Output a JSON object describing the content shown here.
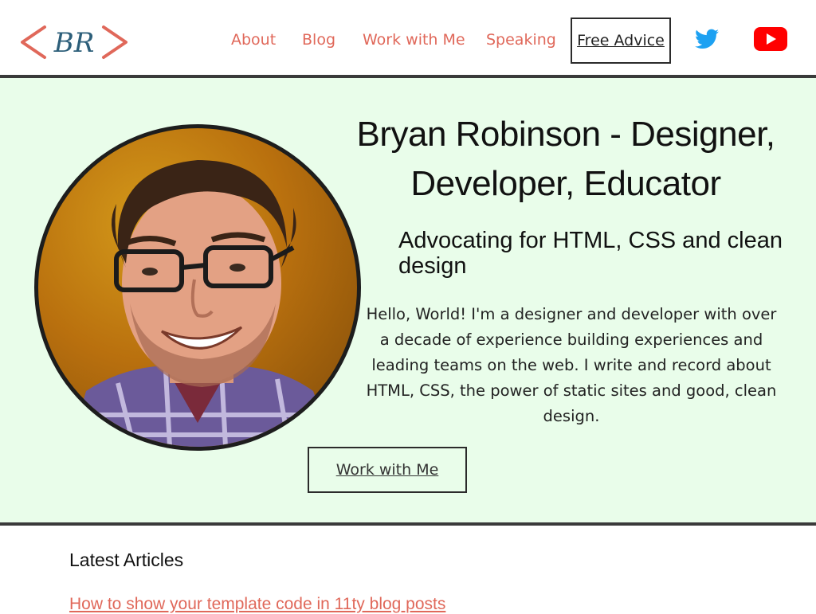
{
  "header": {
    "logo_text": "BR",
    "nav": {
      "about": "About",
      "blog": "Blog",
      "work_with_me": "Work with Me",
      "speaking": "Speaking"
    },
    "free_advice": "Free Advice",
    "social": {
      "twitter_icon": "twitter-icon",
      "youtube_icon": "youtube-icon"
    }
  },
  "hero": {
    "title": "Bryan Robinson - Designer, Developer, Educator",
    "subtitle": "Advocating for HTML, CSS and clean design",
    "bio": "Hello, World! I'm a designer and developer with over a decade of experience building experiences and leading teams on the web. I write and record about HTML, CSS, the power of static sites and good, clean design.",
    "cta": "Work with Me"
  },
  "latest": {
    "heading": "Latest Articles",
    "articles": [
      {
        "title": "How to show your template code in 11ty blog posts"
      }
    ]
  },
  "colors": {
    "accent": "#e0685a",
    "logo_text": "#2d5f7a",
    "hero_bg": "#e9fdea",
    "border": "#2b2b2b",
    "twitter": "#1da1f2",
    "youtube": "#ff0000"
  }
}
